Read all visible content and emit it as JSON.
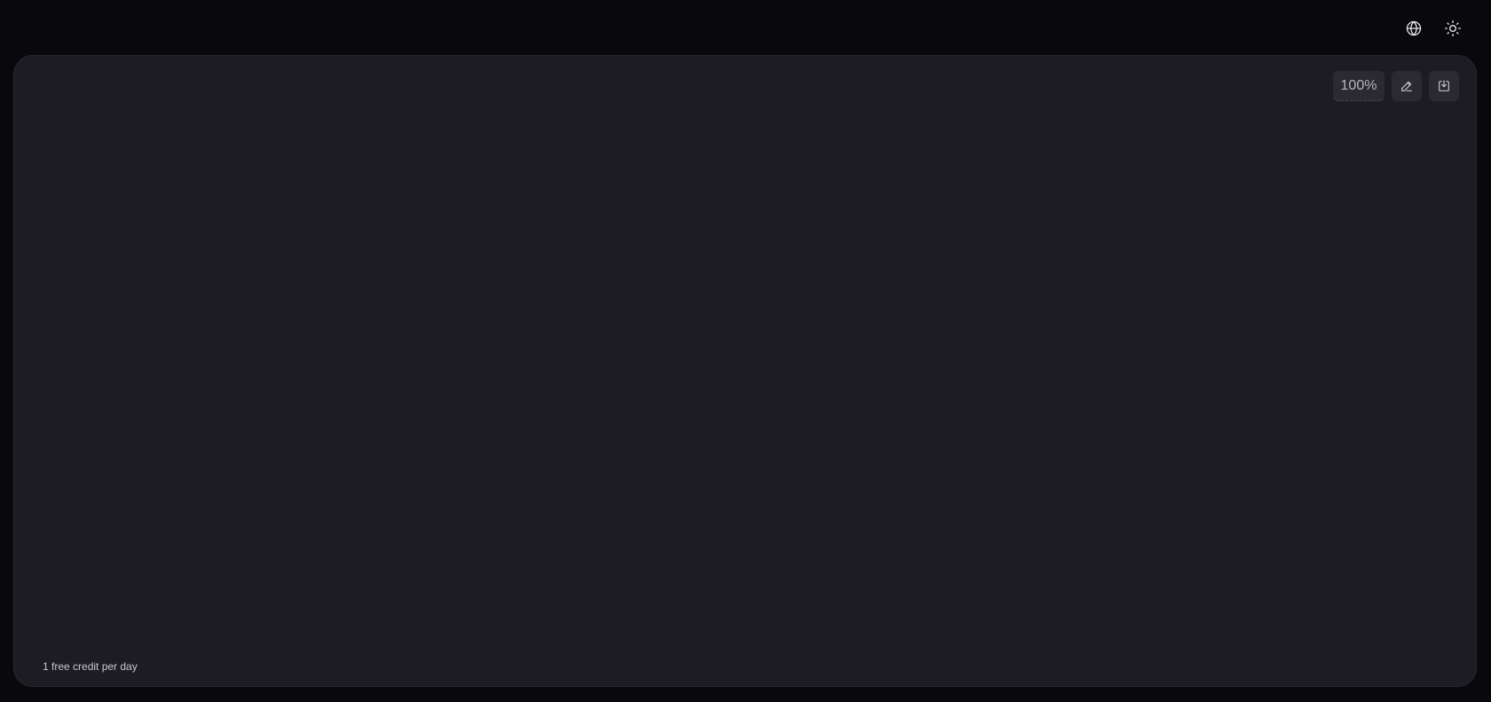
{
  "topbar": {
    "icons": [
      "globe-icon",
      "sun-icon"
    ]
  },
  "panel": {
    "zoom_label": "100%",
    "edit_icon": "pencil-icon",
    "download_icon": "download-icon",
    "footer_note": "1 free credit per day"
  },
  "colors": {
    "page_background": "#08080d",
    "panel_background": "#1d1c22",
    "button_background": "#2b2a31"
  }
}
